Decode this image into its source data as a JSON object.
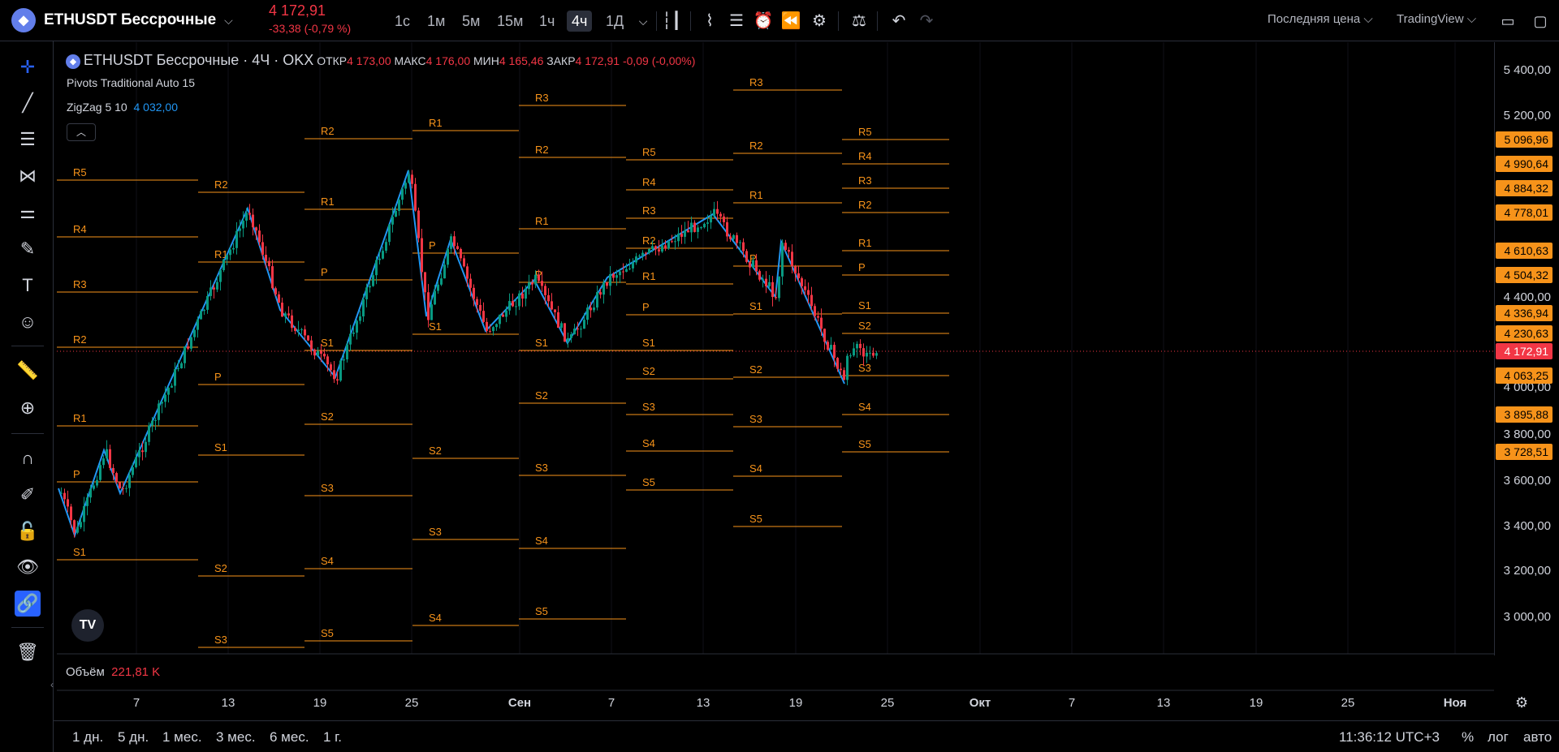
{
  "symbol": {
    "name": "ETHUSDT Бессрочные",
    "price": "4 172,91",
    "change": "-33,38 (-0,79 %)"
  },
  "timeframes": [
    "1с",
    "1м",
    "5м",
    "15м",
    "1ч",
    "4ч",
    "1Д"
  ],
  "active_timeframe": "4ч",
  "top_right": {
    "price_type": "Последняя цена",
    "style": "TradingView"
  },
  "legend": {
    "title": "ETHUSDT Бессрочные · 4Ч · OKX",
    "open_label": "ОТКР",
    "open": "4 173,00",
    "high_label": "МАКС",
    "high": "4 176,00",
    "low_label": "МИН",
    "low": "4 165,46",
    "close_label": "ЗАКР",
    "close": "4 172,91",
    "close_change": "-0,09 (-0,00%)",
    "pivots": "Pivots Traditional Auto 15",
    "zigzag_label": "ZigZag 5 10",
    "zigzag_value": "4 032,00"
  },
  "volume": {
    "label": "Объём",
    "value": "221,81 K"
  },
  "price_axis": {
    "labels": [
      "5 400,00",
      "5 200,00",
      "4 400,00",
      "4 000,00",
      "3 800,00",
      "3 600,00",
      "3 400,00",
      "3 200,00",
      "3 000,00"
    ],
    "pivot_tags": [
      "5 096,96",
      "4 990,64",
      "4 884,32",
      "4 778,01",
      "4 610,63",
      "4 504,32",
      "4 336,94",
      "4 230,63",
      "4 063,25",
      "3 895,88",
      "3 728,51"
    ],
    "current_tag": "4 172,91"
  },
  "time_axis": [
    "7",
    "13",
    "19",
    "25",
    "Сен",
    "7",
    "13",
    "19",
    "25",
    "Окт",
    "7",
    "13",
    "19",
    "25",
    "Ноя"
  ],
  "ranges": [
    "1 дн.",
    "5 дн.",
    "1 мес.",
    "3 мес.",
    "6 мес.",
    "1 г."
  ],
  "bottom_right": {
    "clock": "11:36:12 UTC+3",
    "percent": "%",
    "log": "лог",
    "auto": "авто"
  },
  "pivot_names": [
    "R5",
    "R4",
    "R3",
    "R2",
    "R1",
    "P",
    "S1",
    "S2",
    "S3",
    "S4",
    "S5"
  ],
  "colors": {
    "pivot": "#f7931a",
    "zigzag": "#2196f3",
    "up": "#089981",
    "down": "#f23645",
    "current_line": "#f23645"
  }
}
